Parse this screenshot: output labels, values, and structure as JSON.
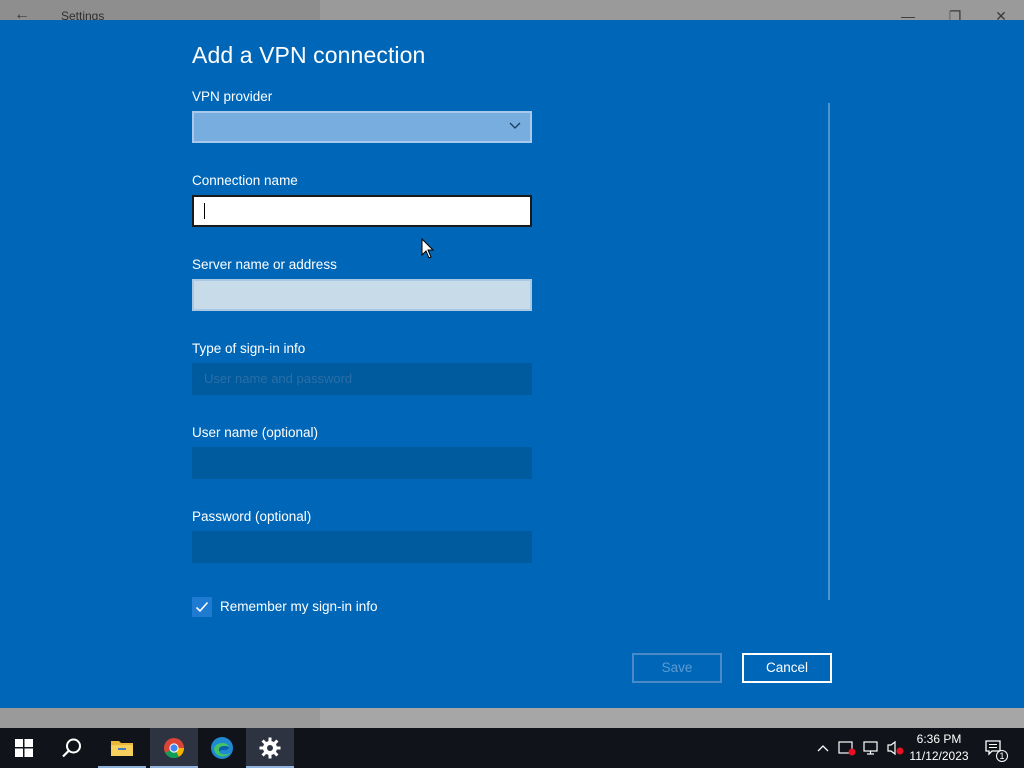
{
  "window": {
    "title": "Settings",
    "back_glyph": "←",
    "minimize_glyph": "—",
    "restore_glyph": "❐",
    "close_glyph": "✕"
  },
  "dialog": {
    "title": "Add a VPN connection",
    "fields": {
      "vpn_provider": {
        "label": "VPN provider",
        "value": ""
      },
      "connection_name": {
        "label": "Connection name",
        "value": ""
      },
      "server_name": {
        "label": "Server name or address",
        "value": ""
      },
      "sign_in_type": {
        "label": "Type of sign-in info",
        "value": "User name and password"
      },
      "user_name": {
        "label": "User name (optional)",
        "value": ""
      },
      "password": {
        "label": "Password (optional)",
        "value": ""
      }
    },
    "remember": {
      "label": "Remember my sign-in info",
      "checked": true
    },
    "save_label": "Save",
    "cancel_label": "Cancel"
  },
  "taskbar": {
    "items": [
      {
        "name": "start",
        "icon": "windows-logo-icon"
      },
      {
        "name": "search",
        "icon": "search-icon"
      },
      {
        "name": "file-explorer",
        "icon": "folder-icon"
      },
      {
        "name": "chrome",
        "icon": "chrome-icon"
      },
      {
        "name": "edge",
        "icon": "edge-icon"
      },
      {
        "name": "settings",
        "icon": "gear-icon"
      }
    ],
    "clock_time": "6:36 PM",
    "clock_date": "11/12/2023",
    "notification_count": "1"
  },
  "colors": {
    "dialog_bg": "#0067b8",
    "taskbar_bg": "#101319"
  }
}
